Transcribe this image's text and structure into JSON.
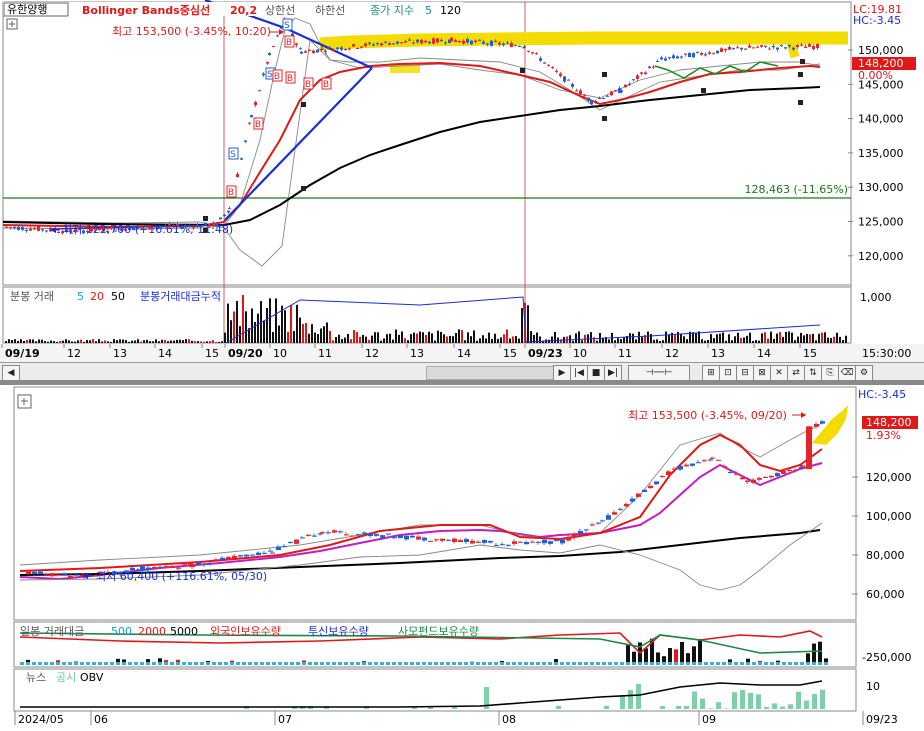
{
  "top": {
    "title_stock": "유한양행",
    "title_indicator": "Bollinger Bands중심선",
    "title_period": "20,2",
    "title_upper": "상한선",
    "title_lower": "하한선",
    "title_close_index": "종가 지수",
    "title_n1": "5",
    "title_n2": "120",
    "lc": "LC:19.81",
    "hc": "HC:-3.45",
    "high_annotation": "최고 153,500 (-3.45%, 10:20)",
    "low_annotation": "최저 122,700 (+16.61%, 11:48)",
    "price_badge": "148,200",
    "change_badge": "0.00%",
    "hline_label": "128,463 (-11.65%)",
    "y_ticks": [
      "150,000",
      "145,000",
      "140,000",
      "135,000",
      "130,000",
      "125,000",
      "120,000"
    ],
    "vol_legend_prefix": "분봉 거래",
    "vol_legend_n5": "5",
    "vol_legend_n20": "20",
    "vol_legend_n50": "50",
    "vol_legend_cum": "분봉거래대금누적",
    "vol_tick": "1,000",
    "x_labels": [
      "09/19",
      "12",
      "13",
      "14",
      "15",
      "09/20",
      "10",
      "11",
      "12",
      "13",
      "14",
      "15",
      "09/23",
      "10",
      "11",
      "12",
      "13",
      "14",
      "15"
    ],
    "time_label": "15:30:00"
  },
  "bottom": {
    "hc": "HC:-3.45",
    "high_annotation": "최고 153,500 (-3.45%, 09/20)",
    "low_annotation": "최저 60,400 (+116.61%, 05/30)",
    "price_badge": "148,200",
    "change_badge": "1.93%",
    "y_ticks": [
      "120,000",
      "100,000",
      "80,000",
      "60,000"
    ],
    "vol_legend": "일봉 거래대금",
    "vol_n1": "500",
    "vol_n2": "2000",
    "vol_n3": "5000",
    "vol_foreign": "외국인보유수량",
    "vol_trust": "투신보유수량",
    "vol_fund": "사모펀드보유수량",
    "vol_tick": "-250,000",
    "obv_news": "뉴스",
    "obv_disclosure": "공시",
    "obv_label": "OBV",
    "obv_tick": "10",
    "x_labels": [
      "2024/05",
      "06",
      "07",
      "08",
      "09",
      "09/23"
    ]
  },
  "colors": {
    "up": "#e3262a",
    "down": "#1e5fd6",
    "ma_red": "#e01818",
    "ma_black": "#000000",
    "ma_magenta": "#c21cc2",
    "highlight": "#f5dc00",
    "hline": "#1a7a1a"
  },
  "chart_data": [
    {
      "type": "candlestick",
      "title": "유한양행 Bollinger Bands중심선 20,2",
      "timeframe": "minute",
      "x_range": [
        "09/19",
        "09/23 15:30"
      ],
      "ylim": [
        117000,
        154000
      ],
      "close_path": [
        [
          "09/19 09:00",
          124600
        ],
        [
          "09/19 11:00",
          124000
        ],
        [
          "09/19 13:00",
          124400
        ],
        [
          "09/19 15:30",
          124900
        ],
        [
          "09/20 09:10",
          127000
        ],
        [
          "09/20 09:40",
          139000
        ],
        [
          "09/20 10:10",
          147000
        ],
        [
          "09/20 10:20",
          151500
        ],
        [
          "09/20 10:40",
          147500
        ],
        [
          "09/20 11:30",
          148000
        ],
        [
          "09/20 12:30",
          148600
        ],
        [
          "09/20 14:00",
          149000
        ],
        [
          "09/20 15:30",
          148300
        ],
        [
          "09/23 10:00",
          141000
        ],
        [
          "09/23 11:00",
          142500
        ],
        [
          "09/23 12:30",
          146500
        ],
        [
          "09/23 14:00",
          148000
        ],
        [
          "09/23 15:30",
          148200
        ]
      ],
      "series": [
        {
          "name": "중심선",
          "color": "#e01818"
        },
        {
          "name": "120",
          "color": "#000000"
        }
      ],
      "annotations": [
        "최고 153,500 (-3.45%, 10:20)",
        "최저 122,700 (+16.61%, 11:48)",
        "128,463 (-11.65%)"
      ]
    },
    {
      "type": "candlestick",
      "timeframe": "daily",
      "x_range": [
        "2024/05",
        "09/23"
      ],
      "ylim": [
        50000,
        160000
      ],
      "close_path": [
        [
          "2024/05/20",
          71000
        ],
        [
          "2024/05/30",
          69000
        ],
        [
          "2024/06/10",
          73000
        ],
        [
          "2024/06/28",
          75000
        ],
        [
          "2024/07/15",
          82000
        ],
        [
          "2024/07/31",
          92000
        ],
        [
          "2024/08/05",
          86000
        ],
        [
          "2024/08/20",
          87000
        ],
        [
          "2024/08/27",
          97000
        ],
        [
          "2024/09/02",
          124000
        ],
        [
          "2024/09/05",
          130000
        ],
        [
          "2024/09/10",
          117000
        ],
        [
          "2024/09/19",
          125000
        ],
        [
          "2024/09/20",
          145000
        ],
        [
          "2024/09/23",
          148200
        ]
      ],
      "annotations": [
        "최고 153,500 (-3.45%, 09/20)",
        "최저 60,400 (+116.61%, 05/30)"
      ]
    }
  ]
}
